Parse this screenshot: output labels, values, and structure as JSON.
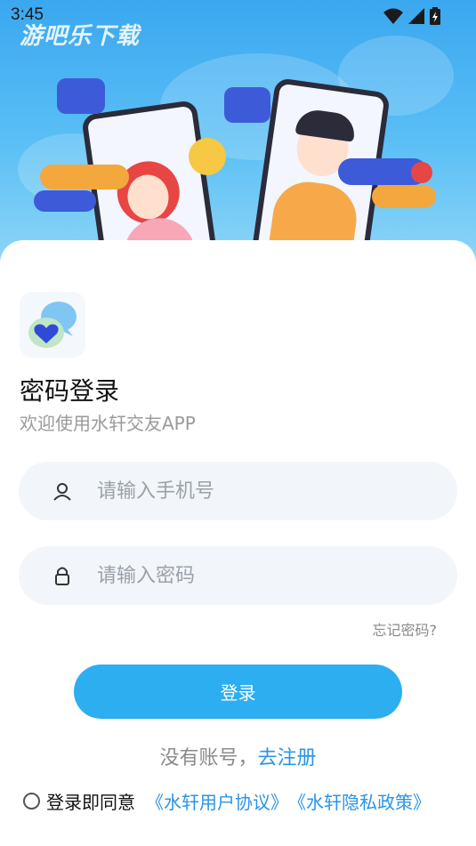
{
  "status_bar": {
    "time": "3:45",
    "icons": [
      "wifi-icon",
      "signal-icon",
      "battery-icon"
    ]
  },
  "watermark": "游吧乐下载",
  "login": {
    "title": "密码登录",
    "subtitle": "欢迎使用水轩交友APP",
    "phone_placeholder": "请输入手机号",
    "password_placeholder": "请输入密码",
    "forgot_label": "忘记密码?",
    "login_button": "登录",
    "no_account_text": "没有账号，",
    "register_link": "去注册",
    "agree_text": "登录即同意",
    "user_agreement": "《水轩用户协议》",
    "privacy_policy": "《水轩隐私政策》"
  },
  "colors": {
    "accent": "#2daef0",
    "link": "#2a94e6",
    "hero_top": "#3aa7ef"
  }
}
